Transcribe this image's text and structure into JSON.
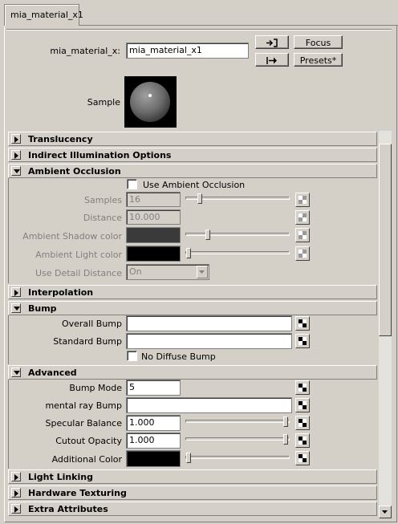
{
  "tab": {
    "label": "mia_material_x1"
  },
  "header": {
    "name_label": "mia_material_x:",
    "name_value": "mia_material_x1",
    "focus_label": "Focus",
    "presets_label": "Presets*",
    "sample_label": "Sample",
    "load_icon": "arrow-into-bracket-icon",
    "output_icon": "arrow-out-icon"
  },
  "sections": {
    "translucency": "Translucency",
    "indirect": "Indirect Illumination Options",
    "ao": "Ambient Occlusion",
    "interpolation": "Interpolation",
    "bump": "Bump",
    "advanced": "Advanced",
    "light_linking": "Light Linking",
    "hw_texturing": "Hardware Texturing",
    "extra": "Extra Attributes"
  },
  "ao": {
    "use_label": "Use Ambient Occlusion",
    "use_checked": false,
    "samples_label": "Samples",
    "samples_value": "16",
    "samples_level": 0.17,
    "distance_label": "Distance",
    "distance_value": "10.000",
    "shadow_label": "Ambient Shadow color",
    "shadow_level": 0.2,
    "light_label": "Ambient Light color",
    "light_level": 0.0,
    "detail_label": "Use Detail Distance",
    "detail_value": "On"
  },
  "bump": {
    "overall_label": "Overall Bump",
    "overall_value": "",
    "standard_label": "Standard Bump",
    "standard_value": "",
    "no_diffuse_label": "No Diffuse Bump",
    "no_diffuse_checked": false
  },
  "advanced": {
    "bump_mode_label": "Bump Mode",
    "bump_mode_value": "5",
    "mr_bump_label": "mental ray Bump",
    "mr_bump_value": "",
    "spec_label": "Specular Balance",
    "spec_value": "1.000",
    "spec_level": 1.0,
    "cutout_label": "Cutout Opacity",
    "cutout_value": "1.000",
    "cutout_level": 1.0,
    "addcolor_label": "Additional Color",
    "addcolor_level": 0.0
  },
  "colors": {
    "background": "#d4d0c8",
    "shadow_swatch": "#3a3a3a",
    "light_swatch": "#000000",
    "additional_swatch": "#000000"
  }
}
